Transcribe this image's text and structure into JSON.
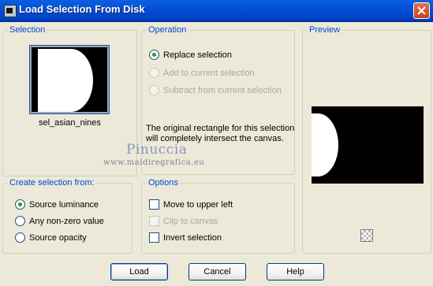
{
  "window": {
    "title": "Load Selection From Disk",
    "icon": "selection-app-icon",
    "close_icon": "close-icon"
  },
  "selection_group": {
    "legend": "Selection",
    "file_name": "sel_asian_nines"
  },
  "operation_group": {
    "legend": "Operation",
    "options": [
      {
        "label": "Replace selection",
        "checked": true,
        "enabled": true
      },
      {
        "label": "Add to current selection",
        "checked": false,
        "enabled": false
      },
      {
        "label": "Subtract from current selection",
        "checked": false,
        "enabled": false
      }
    ],
    "note_line1": "The original rectangle for this selection",
    "note_line2": "will completely intersect the canvas."
  },
  "watermark": {
    "name": "Pinuccia",
    "url": "www.maidiregrafica.eu"
  },
  "preview_group": {
    "legend": "Preview",
    "toggle_icon": "checkerboard-icon"
  },
  "create_from_group": {
    "legend": "Create selection from:",
    "options": [
      {
        "label": "Source luminance",
        "checked": true
      },
      {
        "label": "Any non-zero value",
        "checked": false
      },
      {
        "label": "Source opacity",
        "checked": false
      }
    ]
  },
  "options_group": {
    "legend": "Options",
    "items": [
      {
        "label": "Move to upper left",
        "checked": false,
        "enabled": true
      },
      {
        "label": "Clip to canvas",
        "checked": false,
        "enabled": false
      },
      {
        "label": "Invert selection",
        "checked": false,
        "enabled": true
      }
    ]
  },
  "buttons": {
    "load": "Load",
    "cancel": "Cancel",
    "help": "Help"
  },
  "colors": {
    "titlebar": "#0450D6",
    "legend_text": "#0046D5",
    "dialog_bg": "#ECE9D8"
  }
}
